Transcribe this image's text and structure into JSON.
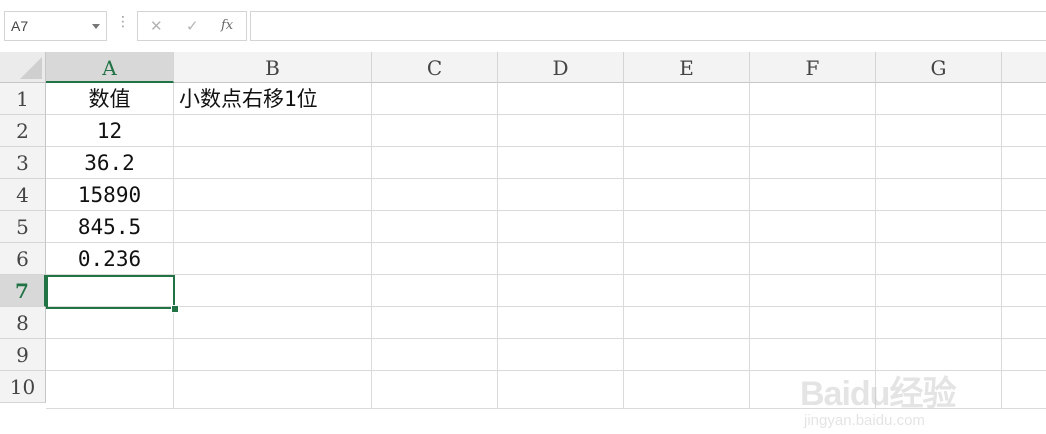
{
  "name_box": {
    "value": "A7"
  },
  "formula_bar": {
    "dots": "⋮",
    "cancel_glyph": "✕",
    "enter_glyph": "✓",
    "fx_label": "fx",
    "value": ""
  },
  "columns": [
    "A",
    "B",
    "C",
    "D",
    "E",
    "F",
    "G"
  ],
  "selected_column": "A",
  "rows": [
    "1",
    "2",
    "3",
    "4",
    "5",
    "6",
    "7",
    "8",
    "9",
    "10"
  ],
  "selected_row": "7",
  "cells": {
    "A1": "数值",
    "B1": "小数点右移1位",
    "A2": "12",
    "A3": "36.2",
    "A4": "15890",
    "A5": "845.5",
    "A6": "0.236",
    "A7": ""
  },
  "active_cell": "A7",
  "watermark": {
    "brand": "Baidu经验",
    "url": "jingyan.baidu.com"
  },
  "colors": {
    "accent": "#217346",
    "gridline": "#dadada",
    "header_bg": "#f3f3f3"
  }
}
